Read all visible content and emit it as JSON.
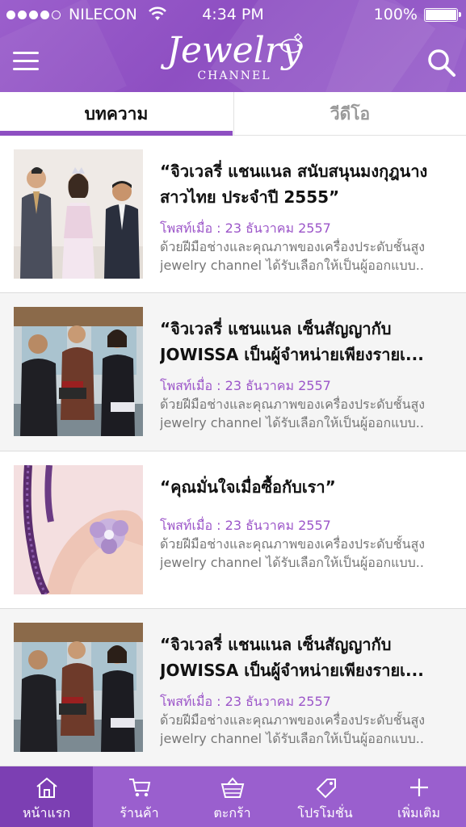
{
  "status_bar": {
    "carrier": "NILECON",
    "time": "4:34 PM",
    "battery": "100%"
  },
  "header": {
    "logo_main": "Jewelry",
    "logo_sub": "CHANNEL"
  },
  "tabs": [
    {
      "label": "บทความ",
      "active": true
    },
    {
      "label": "วีดีโอ",
      "active": false
    }
  ],
  "articles": [
    {
      "title_line1": "“จิวเวลรี่ แชนแนล สนับสนุนมงกุฎนาง",
      "title_line2": "สาวไทย ประจำปี 2555”",
      "date": "โพสท์เมื่อ : 23 ธันวาคม 2557",
      "desc_line1": "ด้วยฝีมือช่างและคุณภาพของเครื่องประดับชั้นสูง",
      "desc_line2": "jewelry channel ได้รับเลือกให้เป็นผู้ออกแบบ.."
    },
    {
      "title_line1": "“จิวเวลรี่ แชนแนล เซ็นสัญญากับ",
      "title_line2": "JOWISSA เป็นผู้จำหน่ายเพียงรายเ...",
      "date": "โพสท์เมื่อ : 23 ธันวาคม 2557",
      "desc_line1": "ด้วยฝีมือช่างและคุณภาพของเครื่องประดับชั้นสูง",
      "desc_line2": "jewelry channel ได้รับเลือกให้เป็นผู้ออกแบบ.."
    },
    {
      "title_line1": "“คุณมั่นใจเมื่อซื้อกับเรา”",
      "title_line2": "",
      "date": "โพสท์เมื่อ : 23 ธันวาคม 2557",
      "desc_line1": "ด้วยฝีมือช่างและคุณภาพของเครื่องประดับชั้นสูง",
      "desc_line2": "jewelry channel ได้รับเลือกให้เป็นผู้ออกแบบ.."
    },
    {
      "title_line1": "“จิวเวลรี่ แชนแนล เซ็นสัญญากับ",
      "title_line2": "JOWISSA เป็นผู้จำหน่ายเพียงรายเ...",
      "date": "โพสท์เมื่อ : 23 ธันวาคม 2557",
      "desc_line1": "ด้วยฝีมือช่างและคุณภาพของเครื่องประดับชั้นสูง",
      "desc_line2": "jewelry channel ได้รับเลือกให้เป็นผู้ออกแบบ.."
    }
  ],
  "bottom_nav": [
    {
      "label": "หน้าแรก",
      "icon": "home-icon",
      "active": true
    },
    {
      "label": "ร้านค้า",
      "icon": "cart-icon",
      "active": false
    },
    {
      "label": "ตะกร้า",
      "icon": "basket-icon",
      "active": false
    },
    {
      "label": "โปรโมชั่น",
      "icon": "tag-icon",
      "active": false
    },
    {
      "label": "เพิ่มเติม",
      "icon": "plus-icon",
      "active": false
    }
  ],
  "colors": {
    "brand_purple": "#8e4fc2",
    "date_purple": "#9c56c9",
    "nav_active": "#7c3fb3"
  }
}
